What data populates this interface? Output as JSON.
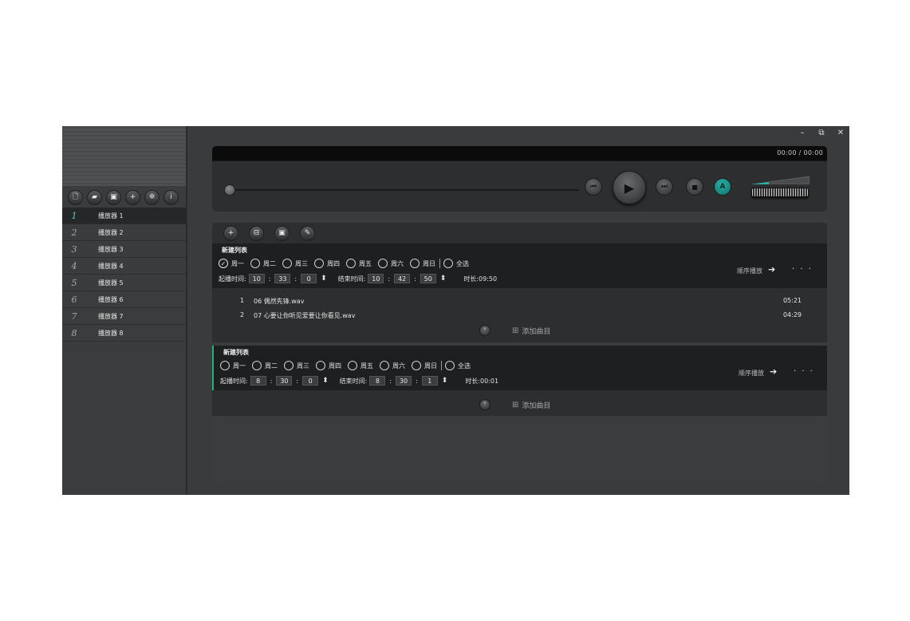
{
  "window": {
    "minimize": "–",
    "restore": "⧉",
    "close": "✕"
  },
  "sidebar": {
    "tools": [
      {
        "name": "new-file-icon",
        "glyph": "🗋"
      },
      {
        "name": "open-folder-icon",
        "glyph": "▰"
      },
      {
        "name": "save-icon",
        "glyph": "▣"
      },
      {
        "name": "add-icon",
        "glyph": "+"
      },
      {
        "name": "settings-icon",
        "glyph": "✲"
      },
      {
        "name": "info-icon",
        "glyph": "i"
      }
    ],
    "players": [
      {
        "num": "1",
        "label": "播放器 1"
      },
      {
        "num": "2",
        "label": "播放器 2"
      },
      {
        "num": "3",
        "label": "播放器 3"
      },
      {
        "num": "4",
        "label": "播放器 4"
      },
      {
        "num": "5",
        "label": "播放器 5"
      },
      {
        "num": "6",
        "label": "播放器 6"
      },
      {
        "num": "7",
        "label": "播放器 7"
      },
      {
        "num": "8",
        "label": "播放器 8"
      }
    ]
  },
  "transport": {
    "time": "00:00  /  00:00",
    "prev": "⏮",
    "play": "▶",
    "next": "⏭",
    "stop": "■",
    "mode": "A",
    "accent": "#2bb0a8"
  },
  "playlist_tools": [
    {
      "name": "add-list-icon",
      "glyph": "+"
    },
    {
      "name": "import-icon",
      "glyph": "⊟"
    },
    {
      "name": "save-list-icon",
      "glyph": "▣"
    },
    {
      "name": "edit-icon",
      "glyph": "✎"
    }
  ],
  "lists": [
    {
      "title": "新建列表",
      "days": [
        "周一",
        "周二",
        "周三",
        "周四",
        "周五",
        "周六",
        "周日"
      ],
      "checked_day": "周一",
      "select_all": "全选",
      "start_label": "起播时间:",
      "start": [
        "10",
        "33",
        "0"
      ],
      "end_label": "结束时间:",
      "end": [
        "10",
        "42",
        "50"
      ],
      "duration": "时长:09:50",
      "mode": "顺序播放",
      "tracks": [
        {
          "idx": "1",
          "name": "06 偶然先锋.wav",
          "dur": "05:21"
        },
        {
          "idx": "2",
          "name": "07 心要让你听见爱要让你看见.wav",
          "dur": "04:29"
        }
      ],
      "add_label": "添加曲目"
    },
    {
      "title": "新建列表",
      "days": [
        "周一",
        "周二",
        "周三",
        "周四",
        "周五",
        "周六",
        "周日"
      ],
      "select_all": "全选",
      "start_label": "起播时间:",
      "start": [
        "8",
        "30",
        "0"
      ],
      "end_label": "结束时间:",
      "end": [
        "8",
        "30",
        "1"
      ],
      "duration": "时长:00:01",
      "mode": "顺序播放",
      "tracks": [],
      "add_label": "添加曲目"
    }
  ],
  "glyphs": {
    "check": "✓",
    "spin": "⬍",
    "arrow": "➔",
    "more": "· · ·",
    "collapse": "˄",
    "add_track": "⊞"
  }
}
